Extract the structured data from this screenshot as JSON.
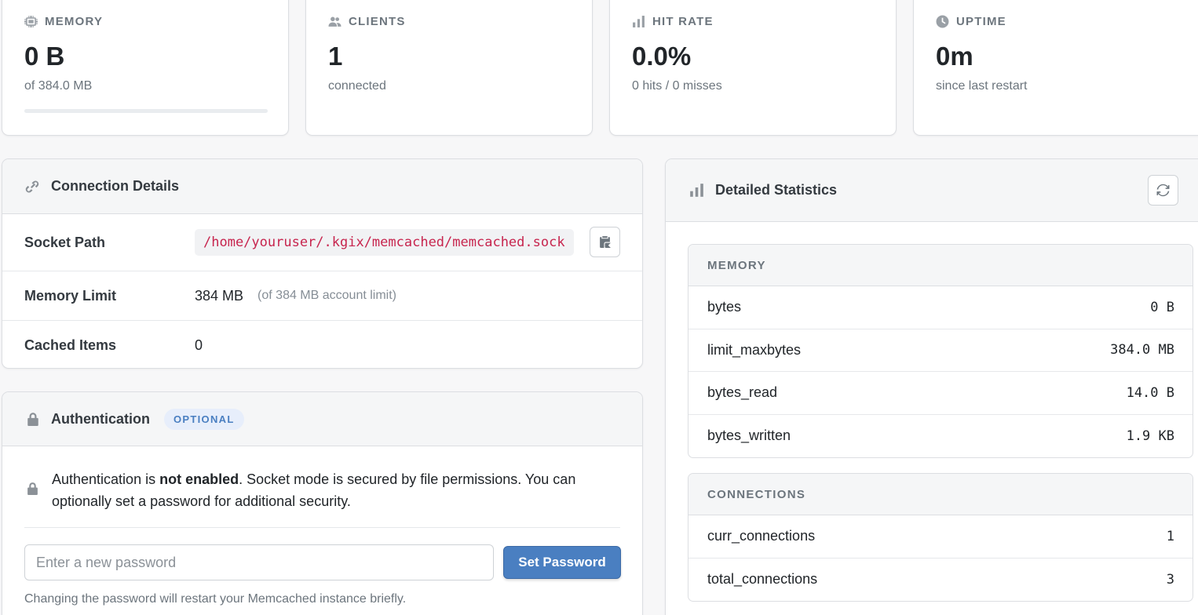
{
  "stats": [
    {
      "label": "MEMORY",
      "icon": "chip-icon",
      "value": "0 B",
      "sub": "of 384.0 MB",
      "progress": 0
    },
    {
      "label": "CLIENTS",
      "icon": "users-icon",
      "value": "1",
      "sub": "connected"
    },
    {
      "label": "HIT RATE",
      "icon": "bar-chart-icon",
      "value": "0.0%",
      "sub": "0 hits / 0 misses"
    },
    {
      "label": "UPTIME",
      "icon": "clock-icon",
      "value": "0m",
      "sub": "since last restart"
    }
  ],
  "connection": {
    "title": "Connection Details",
    "socket_label": "Socket Path",
    "socket_value": "/home/youruser/.kgix/memcached/memcached.sock",
    "memory_label": "Memory Limit",
    "memory_value": "384 MB",
    "memory_note": "(of 384 MB account limit)",
    "items_label": "Cached Items",
    "items_value": "0"
  },
  "auth": {
    "title": "Authentication",
    "badge": "OPTIONAL",
    "msg_prefix": "Authentication is ",
    "msg_bold": "not enabled",
    "msg_suffix": ". Socket mode is secured by file permissions. You can optionally set a password for additional security.",
    "placeholder": "Enter a new password",
    "button": "Set Password",
    "hint": "Changing the password will restart your Memcached instance briefly."
  },
  "detailed": {
    "title": "Detailed Statistics",
    "sections": [
      {
        "title": "MEMORY",
        "rows": [
          {
            "key": "bytes",
            "value": "0 B"
          },
          {
            "key": "limit_maxbytes",
            "value": "384.0 MB"
          },
          {
            "key": "bytes_read",
            "value": "14.0 B"
          },
          {
            "key": "bytes_written",
            "value": "1.9 KB"
          }
        ]
      },
      {
        "title": "CONNECTIONS",
        "rows": [
          {
            "key": "curr_connections",
            "value": "1"
          },
          {
            "key": "total_connections",
            "value": "3"
          }
        ]
      }
    ]
  },
  "colors": {
    "accent": "#4a7fc1",
    "code": "#c7254e",
    "muted": "#6c757d"
  }
}
